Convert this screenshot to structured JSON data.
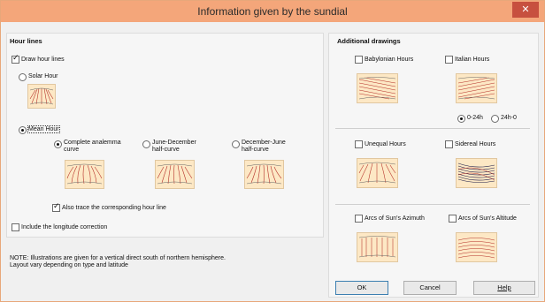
{
  "window": {
    "title": "Information given by the sundial",
    "close_glyph": "✕"
  },
  "hour_lines": {
    "group_title": "Hour lines",
    "draw_hour_lines": {
      "label": "Draw hour lines",
      "checked": true
    },
    "solar_hour": {
      "label": "Solar Hour",
      "selected": false
    },
    "mean_hour": {
      "label": "Mean Hour",
      "selected": true
    },
    "complete_analemma": {
      "line1": "Complete analemma",
      "line2": "curve",
      "selected": true
    },
    "june_december": {
      "line1": "June-December",
      "line2": "half-curve",
      "selected": false
    },
    "december_june": {
      "line1": "December-June",
      "line2": "half-curve",
      "selected": false
    },
    "also_trace": {
      "label": "Also trace the corresponding hour line",
      "checked": true
    }
  },
  "longitude_correction": {
    "label": "Include the longitude correction",
    "checked": false
  },
  "note": {
    "line1": "NOTE: Illustrations are given for a vertical direct south of northern hemisphere.",
    "line2": "Layout vary depending on type and latitude"
  },
  "additional_drawings": {
    "group_title": "Additional drawings",
    "babylonian": {
      "label": "Babylonian Hours",
      "checked": false
    },
    "italian": {
      "label": "Italian Hours",
      "checked": false
    },
    "range_0_24": {
      "label": "0-24h",
      "selected": true
    },
    "range_24_0": {
      "label": "24h-0",
      "selected": false
    },
    "unequal": {
      "label": "Unequal Hours",
      "checked": false
    },
    "sidereal": {
      "label": "Sidereal Hours",
      "checked": false
    },
    "azimuth": {
      "label": "Arcs of Sun's Azimuth",
      "checked": false
    },
    "altitude": {
      "label": "Arcs of Sun's Altitude",
      "checked": false
    }
  },
  "buttons": {
    "ok": "OK",
    "cancel": "Cancel",
    "help": "Help"
  },
  "colors": {
    "titlebar": "#f4a67a",
    "close": "#c7503f",
    "thumb_bg": "#fde8c5",
    "line_red": "#b5312a"
  },
  "icons": {
    "solar": "solar-hour-lines",
    "analemma": "analemma-lines",
    "june_dec": "half-curve-lines",
    "dec_june": "half-curve-lines",
    "babylonian": "babylonian-lines",
    "italian": "italian-lines",
    "unequal": "unequal-lines",
    "sidereal": "sidereal-lines",
    "azimuth": "azimuth-arcs",
    "altitude": "altitude-arcs"
  }
}
